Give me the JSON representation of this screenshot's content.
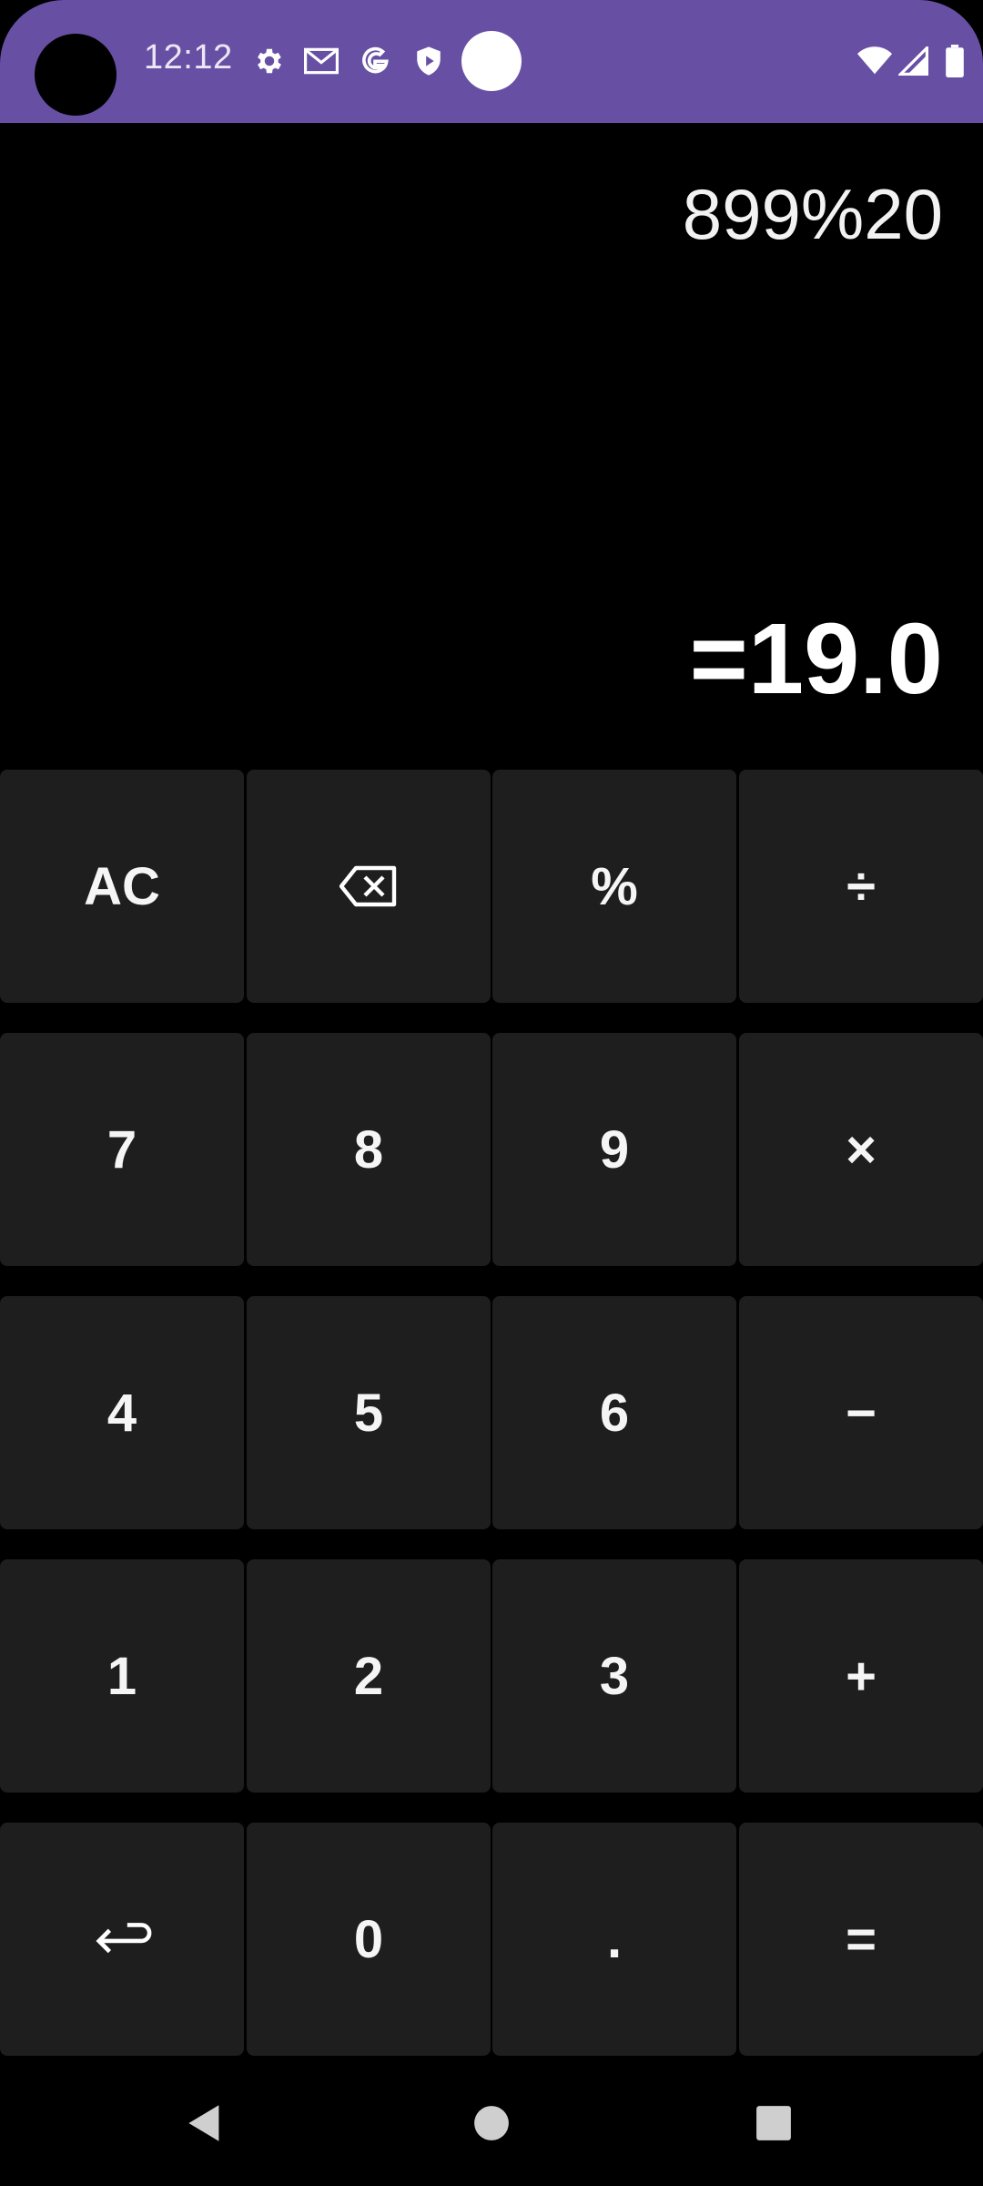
{
  "status_bar": {
    "time": "12:12",
    "icons": [
      "settings-icon",
      "gmail-icon",
      "google-icon",
      "shield-icon",
      "wifi-icon",
      "signal-icon",
      "battery-icon"
    ],
    "accent_color": "#6750a4"
  },
  "display": {
    "expression": "899%20",
    "result": "=19.0"
  },
  "keypad": {
    "row1": [
      "AC",
      "backspace-icon",
      "%",
      "÷"
    ],
    "row2": [
      "7",
      "8",
      "9",
      "×"
    ],
    "row3": [
      "4",
      "5",
      "6",
      "−"
    ],
    "row4": [
      "1",
      "2",
      "3",
      "+"
    ],
    "row5": [
      "return-icon",
      "0",
      ".",
      "="
    ],
    "key_color": "#1e1e1e"
  },
  "nav_bar": {
    "icons": [
      "back-icon",
      "home-icon",
      "recents-icon"
    ]
  }
}
